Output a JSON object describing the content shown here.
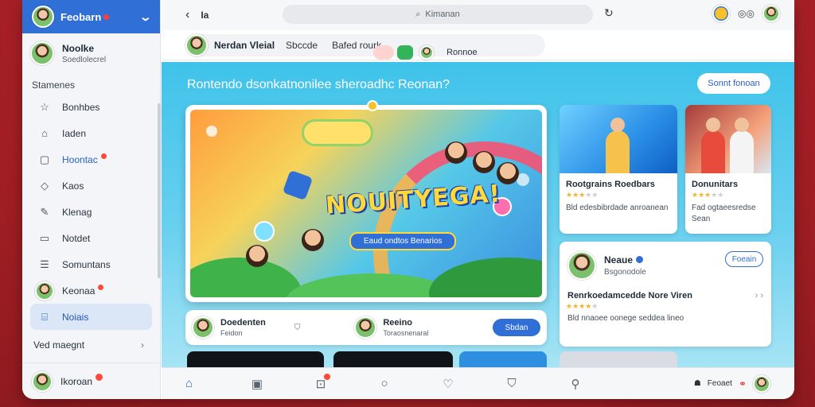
{
  "sidebar": {
    "header_title": "Feobarn",
    "profile": {
      "name": "Noolke",
      "subtitle": "Soedlolecrel"
    },
    "section_title": "Stamenes",
    "items": [
      {
        "label": "Bonhbes",
        "icon": "star-icon"
      },
      {
        "label": "Iaden",
        "icon": "tag-icon"
      },
      {
        "label": "Hoontac",
        "icon": "bookmark-icon"
      },
      {
        "label": "Kaos",
        "icon": "diamond-icon"
      },
      {
        "label": "Klenag",
        "icon": "puzzle-icon"
      },
      {
        "label": "Notdet",
        "icon": "note-icon"
      },
      {
        "label": "Somuntans",
        "icon": "list-icon"
      },
      {
        "label": "Keonaa",
        "icon": "avatar"
      },
      {
        "label": "Noiais",
        "icon": "inbox-icon"
      }
    ],
    "more_label": "Ved maegnt",
    "footer_name": "Ikoroan"
  },
  "topbar": {
    "crumb": "Ia",
    "search_placeholder": "Kimanan"
  },
  "subbar": {
    "title": "Nerdan Vleial",
    "tab1": "Sbccde",
    "tab2": "Bafed rourk",
    "user_name": "Ronnoe"
  },
  "content": {
    "headline": "Rontendo dsonkatnonilee sheroadhc Reonan?",
    "top_button": "Sonnt fonoan",
    "hero": {
      "title": "NOUITYEGA!",
      "subtitle": "Eaud ondtos Benarios"
    },
    "cards": [
      {
        "title": "Rootgrains Roedbars",
        "desc": "Bld edesbibrdade anroanean"
      },
      {
        "title": "Donunitars",
        "desc": "Fad ogtaeesredse Sean"
      }
    ],
    "profile_card": {
      "name": "Neaue",
      "subtitle": "Bsgonodole",
      "button": "Foeain",
      "line_title": "Renrkoedamcedde Nore Viren",
      "desc": "Bld nnaoee oonege seddea lineo"
    },
    "row_card": {
      "person1_name": "Doedenten",
      "person1_sub": "Feidon",
      "person2_name": "Reeino",
      "person2_sub": "Toraosnenaral",
      "button": "Sbdan"
    }
  },
  "bottombar": {
    "right_label": "Feoaet"
  },
  "colors": {
    "accent": "#2f6fd6",
    "content_bg": "#3fc3ea",
    "badge": "#ff4a3a"
  }
}
